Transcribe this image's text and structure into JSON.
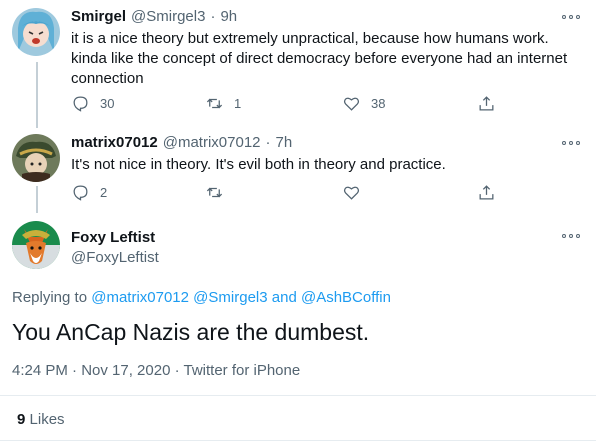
{
  "tweets": [
    {
      "name": "Smirgel",
      "handle": "@Smirgel3",
      "sep": "·",
      "time": "9h",
      "text": "it is a nice theory but extremely unpractical, because how humans work. kinda like the concept of direct democracy before everyone had an internet connection",
      "replies": "30",
      "retweets": "1",
      "likes": "38"
    },
    {
      "name": "matrix07012",
      "handle": "@matrix07012",
      "sep": "·",
      "time": "7h",
      "text": "It's not nice in theory. It's evil both in theory and practice.",
      "replies": "2",
      "retweets": "",
      "likes": ""
    }
  ],
  "main": {
    "name": "Foxy Leftist",
    "handle": "@FoxyLeftist",
    "replying_prefix": "Replying to",
    "replying_users": [
      "@matrix07012",
      "@Smirgel3",
      "@AshBCoffin"
    ],
    "replying_and": "and",
    "text": "You AnCap Nazis are the dumbest.",
    "timestamp": "4:24 PM · Nov 17, 2020 · Twitter for iPhone",
    "likes_count": "9",
    "likes_label": "Likes"
  },
  "colors": {
    "accent": "#1d9bf0",
    "secondary_text": "#536471",
    "thread_line": "#c4cfd6"
  },
  "icons": [
    "reply-icon",
    "retweet-icon",
    "like-icon",
    "share-icon",
    "more-icon"
  ]
}
